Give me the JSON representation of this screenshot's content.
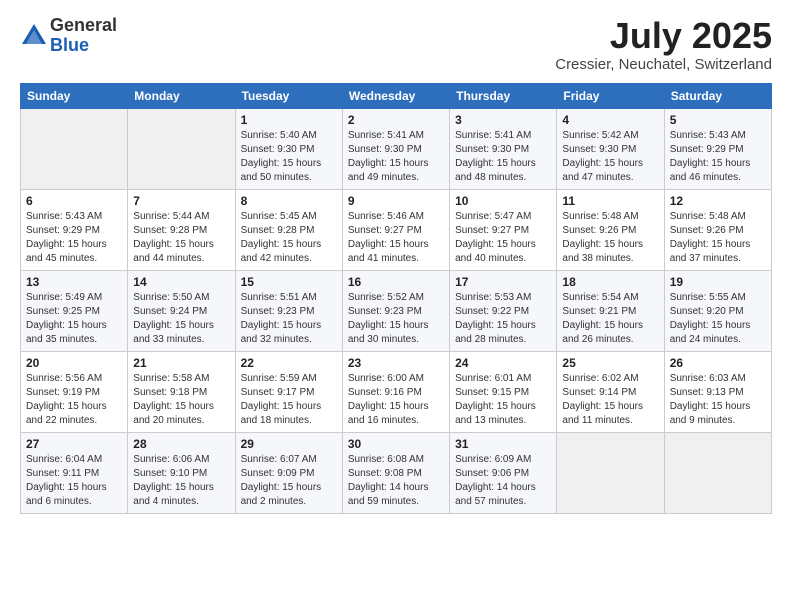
{
  "header": {
    "logo_general": "General",
    "logo_blue": "Blue",
    "title": "July 2025",
    "subtitle": "Cressier, Neuchatel, Switzerland"
  },
  "weekdays": [
    "Sunday",
    "Monday",
    "Tuesday",
    "Wednesday",
    "Thursday",
    "Friday",
    "Saturday"
  ],
  "weeks": [
    [
      {
        "day": "",
        "info": ""
      },
      {
        "day": "",
        "info": ""
      },
      {
        "day": "1",
        "info": "Sunrise: 5:40 AM\nSunset: 9:30 PM\nDaylight: 15 hours\nand 50 minutes."
      },
      {
        "day": "2",
        "info": "Sunrise: 5:41 AM\nSunset: 9:30 PM\nDaylight: 15 hours\nand 49 minutes."
      },
      {
        "day": "3",
        "info": "Sunrise: 5:41 AM\nSunset: 9:30 PM\nDaylight: 15 hours\nand 48 minutes."
      },
      {
        "day": "4",
        "info": "Sunrise: 5:42 AM\nSunset: 9:30 PM\nDaylight: 15 hours\nand 47 minutes."
      },
      {
        "day": "5",
        "info": "Sunrise: 5:43 AM\nSunset: 9:29 PM\nDaylight: 15 hours\nand 46 minutes."
      }
    ],
    [
      {
        "day": "6",
        "info": "Sunrise: 5:43 AM\nSunset: 9:29 PM\nDaylight: 15 hours\nand 45 minutes."
      },
      {
        "day": "7",
        "info": "Sunrise: 5:44 AM\nSunset: 9:28 PM\nDaylight: 15 hours\nand 44 minutes."
      },
      {
        "day": "8",
        "info": "Sunrise: 5:45 AM\nSunset: 9:28 PM\nDaylight: 15 hours\nand 42 minutes."
      },
      {
        "day": "9",
        "info": "Sunrise: 5:46 AM\nSunset: 9:27 PM\nDaylight: 15 hours\nand 41 minutes."
      },
      {
        "day": "10",
        "info": "Sunrise: 5:47 AM\nSunset: 9:27 PM\nDaylight: 15 hours\nand 40 minutes."
      },
      {
        "day": "11",
        "info": "Sunrise: 5:48 AM\nSunset: 9:26 PM\nDaylight: 15 hours\nand 38 minutes."
      },
      {
        "day": "12",
        "info": "Sunrise: 5:48 AM\nSunset: 9:26 PM\nDaylight: 15 hours\nand 37 minutes."
      }
    ],
    [
      {
        "day": "13",
        "info": "Sunrise: 5:49 AM\nSunset: 9:25 PM\nDaylight: 15 hours\nand 35 minutes."
      },
      {
        "day": "14",
        "info": "Sunrise: 5:50 AM\nSunset: 9:24 PM\nDaylight: 15 hours\nand 33 minutes."
      },
      {
        "day": "15",
        "info": "Sunrise: 5:51 AM\nSunset: 9:23 PM\nDaylight: 15 hours\nand 32 minutes."
      },
      {
        "day": "16",
        "info": "Sunrise: 5:52 AM\nSunset: 9:23 PM\nDaylight: 15 hours\nand 30 minutes."
      },
      {
        "day": "17",
        "info": "Sunrise: 5:53 AM\nSunset: 9:22 PM\nDaylight: 15 hours\nand 28 minutes."
      },
      {
        "day": "18",
        "info": "Sunrise: 5:54 AM\nSunset: 9:21 PM\nDaylight: 15 hours\nand 26 minutes."
      },
      {
        "day": "19",
        "info": "Sunrise: 5:55 AM\nSunset: 9:20 PM\nDaylight: 15 hours\nand 24 minutes."
      }
    ],
    [
      {
        "day": "20",
        "info": "Sunrise: 5:56 AM\nSunset: 9:19 PM\nDaylight: 15 hours\nand 22 minutes."
      },
      {
        "day": "21",
        "info": "Sunrise: 5:58 AM\nSunset: 9:18 PM\nDaylight: 15 hours\nand 20 minutes."
      },
      {
        "day": "22",
        "info": "Sunrise: 5:59 AM\nSunset: 9:17 PM\nDaylight: 15 hours\nand 18 minutes."
      },
      {
        "day": "23",
        "info": "Sunrise: 6:00 AM\nSunset: 9:16 PM\nDaylight: 15 hours\nand 16 minutes."
      },
      {
        "day": "24",
        "info": "Sunrise: 6:01 AM\nSunset: 9:15 PM\nDaylight: 15 hours\nand 13 minutes."
      },
      {
        "day": "25",
        "info": "Sunrise: 6:02 AM\nSunset: 9:14 PM\nDaylight: 15 hours\nand 11 minutes."
      },
      {
        "day": "26",
        "info": "Sunrise: 6:03 AM\nSunset: 9:13 PM\nDaylight: 15 hours\nand 9 minutes."
      }
    ],
    [
      {
        "day": "27",
        "info": "Sunrise: 6:04 AM\nSunset: 9:11 PM\nDaylight: 15 hours\nand 6 minutes."
      },
      {
        "day": "28",
        "info": "Sunrise: 6:06 AM\nSunset: 9:10 PM\nDaylight: 15 hours\nand 4 minutes."
      },
      {
        "day": "29",
        "info": "Sunrise: 6:07 AM\nSunset: 9:09 PM\nDaylight: 15 hours\nand 2 minutes."
      },
      {
        "day": "30",
        "info": "Sunrise: 6:08 AM\nSunset: 9:08 PM\nDaylight: 14 hours\nand 59 minutes."
      },
      {
        "day": "31",
        "info": "Sunrise: 6:09 AM\nSunset: 9:06 PM\nDaylight: 14 hours\nand 57 minutes."
      },
      {
        "day": "",
        "info": ""
      },
      {
        "day": "",
        "info": ""
      }
    ]
  ]
}
